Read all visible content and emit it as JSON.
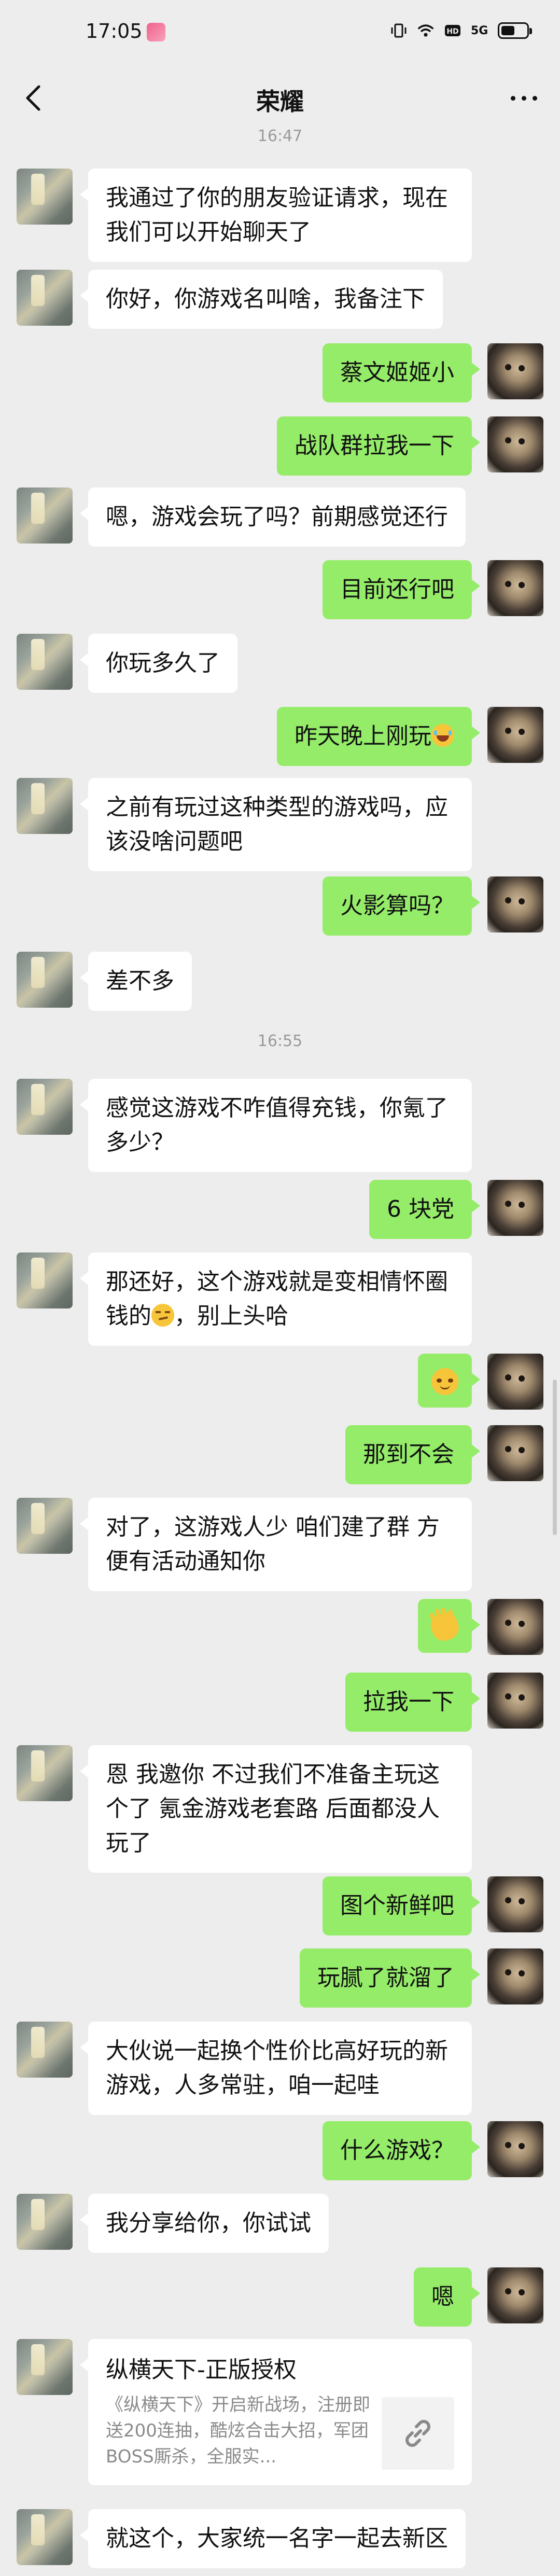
{
  "status_bar": {
    "time": "17:05",
    "signal_text": "5G",
    "battery_level": 0.55
  },
  "header": {
    "title": "荣耀"
  },
  "messages": [
    {
      "kind": "time",
      "text": "16:47"
    },
    {
      "kind": "in",
      "text": "我通过了你的朋友验证请求，现在我们可以开始聊天了"
    },
    {
      "kind": "in",
      "text": "你好，你游戏名叫啥，我备注下"
    },
    {
      "kind": "out",
      "text": "蔡文姬姬小"
    },
    {
      "kind": "out",
      "text": "战队群拉我一下"
    },
    {
      "kind": "in",
      "text": "嗯，游戏会玩了吗？前期感觉还行"
    },
    {
      "kind": "out",
      "text": "目前还行吧"
    },
    {
      "kind": "in",
      "text": "你玩多久了"
    },
    {
      "kind": "out",
      "text": "昨天晚上刚玩",
      "emoji": "laughing-tears"
    },
    {
      "kind": "in",
      "text": "之前有玩过这种类型的游戏吗，应该没啥问题吧"
    },
    {
      "kind": "out",
      "text": "火影算吗？"
    },
    {
      "kind": "in",
      "text": "差不多"
    },
    {
      "kind": "time",
      "text": "16:55"
    },
    {
      "kind": "in",
      "text": "感觉这游戏不咋值得充钱，你氪了多少？"
    },
    {
      "kind": "out",
      "text": "6 块党"
    },
    {
      "kind": "in",
      "text": "那还好，这个游戏就是变相情怀圈钱的",
      "tail": "，别上头哈",
      "emoji": "smirk"
    },
    {
      "kind": "out",
      "text": "",
      "emoji": "cat-face"
    },
    {
      "kind": "out",
      "text": "那到不会"
    },
    {
      "kind": "in",
      "text": "对了，这游戏人少 咱们建了群 方便有活动通知你"
    },
    {
      "kind": "out",
      "text": "",
      "emoji": "waving-hand"
    },
    {
      "kind": "out",
      "text": "拉我一下"
    },
    {
      "kind": "in",
      "text": "恩 我邀你 不过我们不准备主玩这个了 氪金游戏老套路 后面都没人玩了"
    },
    {
      "kind": "out",
      "text": "图个新鲜吧"
    },
    {
      "kind": "out",
      "text": "玩腻了就溜了"
    },
    {
      "kind": "in",
      "text": "大伙说一起换个性价比高好玩的新游戏，人多常驻，咱一起哇"
    },
    {
      "kind": "out",
      "text": "什么游戏？"
    },
    {
      "kind": "in",
      "text": "我分享给你，你试试"
    },
    {
      "kind": "out",
      "text": "嗯"
    },
    {
      "kind": "card",
      "title": "纵横天下-正版授权",
      "desc": "《纵横天下》开启新战场，注册即送200连抽，酷炫合击大招，军团BOSS厮杀，全服实..."
    },
    {
      "kind": "in",
      "text": "就这个，大家统一名字一起去新区"
    }
  ]
}
